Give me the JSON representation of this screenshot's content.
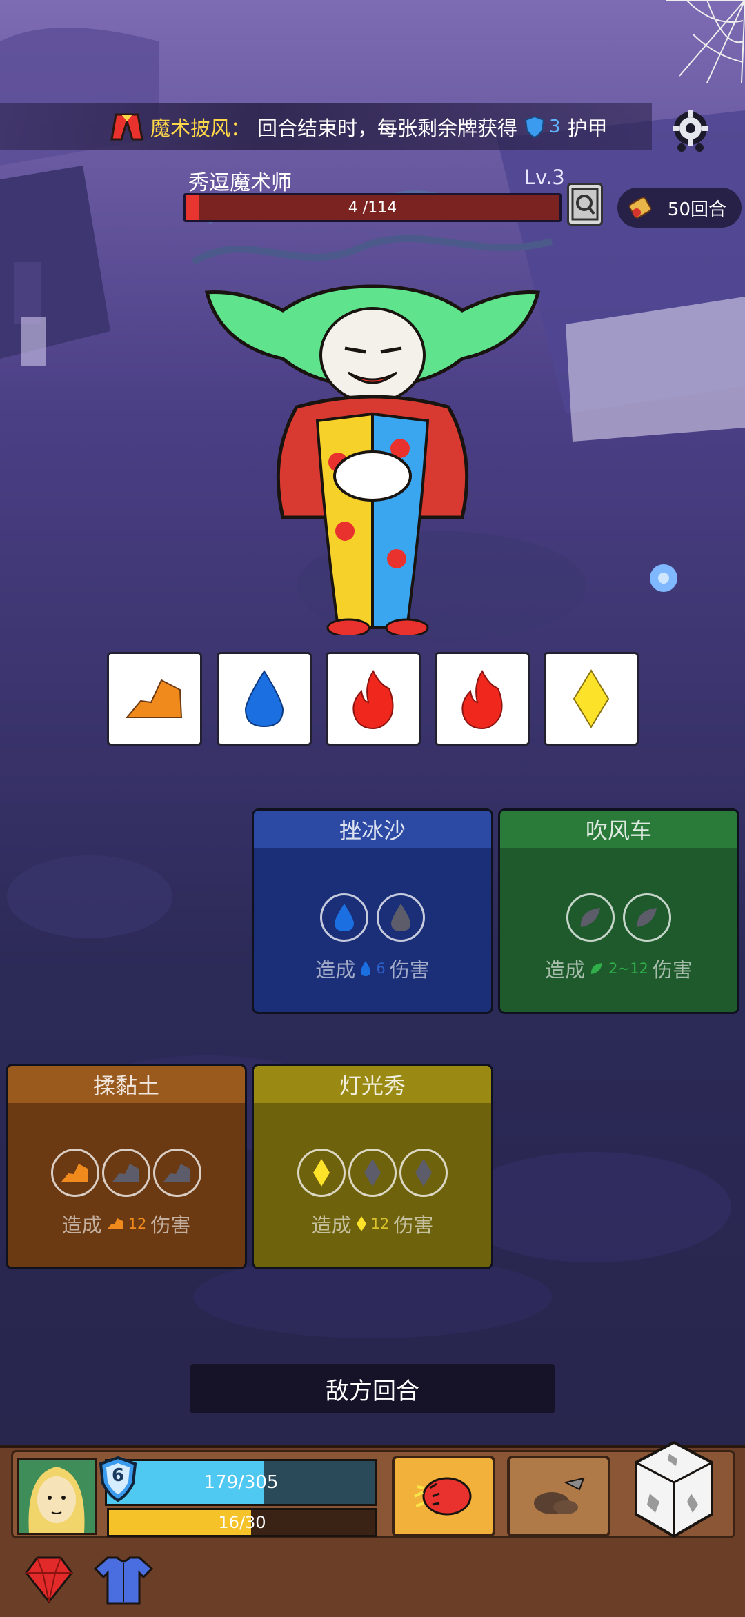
{
  "relic": {
    "name": "魔术披风：",
    "text_before": "回合结束时，每张剩余牌获得",
    "shield_value": "3",
    "text_after": "护甲"
  },
  "enemy": {
    "name": "秀逗魔术师",
    "level": "Lv.3",
    "hp_text": "4 /114",
    "hp_current": 4,
    "hp_max": 114
  },
  "round_counter": "50回合",
  "dice_tiles": [
    {
      "element": "earth",
      "color": "#f08a1c"
    },
    {
      "element": "water",
      "color": "#1c6fe0"
    },
    {
      "element": "fire",
      "color": "#f0271c"
    },
    {
      "element": "fire",
      "color": "#f0271c"
    },
    {
      "element": "light",
      "color": "#fde22a"
    }
  ],
  "skills": [
    {
      "name": "挫冰沙",
      "desc_pre": "造成",
      "value": "6",
      "desc_post": "伤害",
      "slots": 2,
      "element": "water",
      "color": "#1a2f78"
    },
    {
      "name": "吹风车",
      "desc_pre": "造成",
      "value": "2~12",
      "desc_post": "伤害",
      "slots": 2,
      "element": "wind",
      "color": "#1f5a2c"
    },
    {
      "name": "揉黏土",
      "desc_pre": "造成",
      "value": "12",
      "desc_post": "伤害",
      "slots": 3,
      "element": "earth",
      "color": "#6b3a12"
    },
    {
      "name": "灯光秀",
      "desc_pre": "造成",
      "value": "12",
      "desc_post": "伤害",
      "slots": 3,
      "element": "light",
      "color": "#6f620c"
    }
  ],
  "turn_banner": "敌方回合",
  "player": {
    "armor": "6",
    "hp_text": "179/305",
    "hp_current": 179,
    "hp_max": 305,
    "energy_text": "16/30",
    "energy_current": 16,
    "energy_max": 30
  },
  "icons": [
    "gear-icon",
    "scroll-icon",
    "dice-icon",
    "gem-icon",
    "armor-shirt-icon",
    "fist-skill-icon",
    "dust-skill-icon"
  ]
}
